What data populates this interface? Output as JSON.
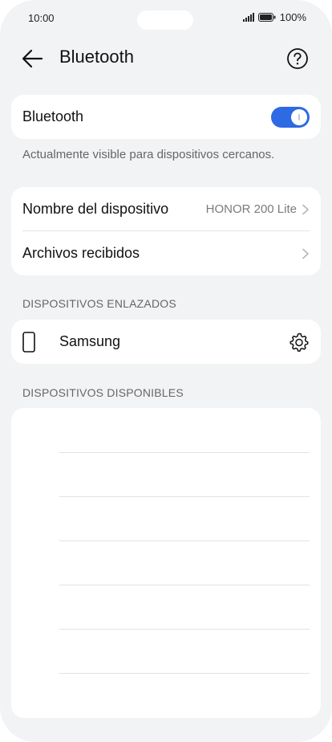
{
  "status_bar": {
    "time": "10:00",
    "battery": "100%"
  },
  "header": {
    "title": "Bluetooth",
    "back_icon": "arrow-left-icon",
    "help_icon": "question-circle-icon"
  },
  "bluetooth_toggle": {
    "label": "Bluetooth",
    "enabled": true
  },
  "visibility_hint": "Actualmente visible para dispositivos cercanos.",
  "settings": {
    "device_name_label": "Nombre del dispositivo",
    "device_name_value": "HONOR 200 Lite",
    "received_files_label": "Archivos recibidos"
  },
  "paired_section": {
    "title": "DISPOSITIVOS ENLAZADOS",
    "devices": [
      {
        "name": "Samsung",
        "icon": "smartphone-icon"
      }
    ]
  },
  "available_section": {
    "title": "DISPOSITIVOS DISPONIBLES",
    "devices": []
  },
  "colors": {
    "accent": "#2d6ae3",
    "background": "#f1f3f5",
    "card": "#ffffff"
  }
}
